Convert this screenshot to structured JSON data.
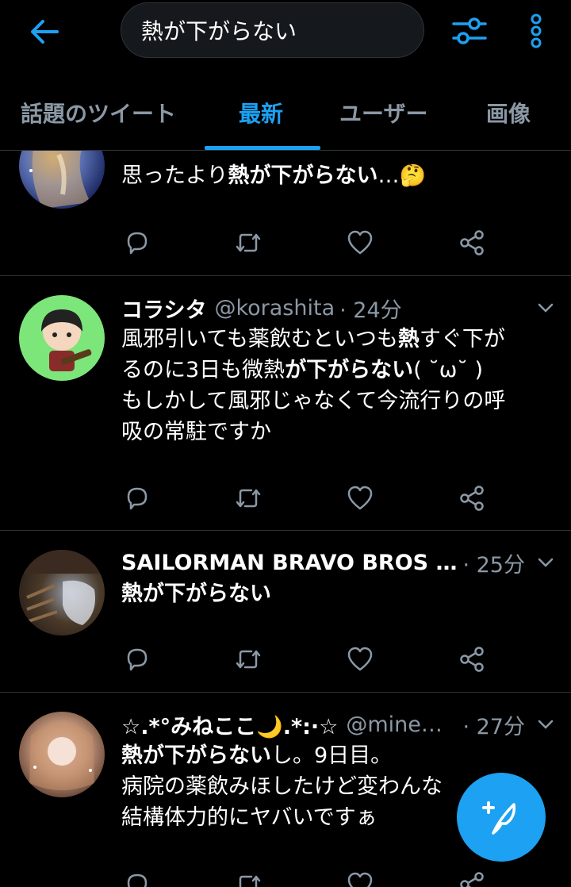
{
  "search": {
    "query": "熱が下がらない"
  },
  "tabs": [
    {
      "label": "話題のツイート",
      "active": false
    },
    {
      "label": "最新",
      "active": true
    },
    {
      "label": "ユーザー",
      "active": false
    },
    {
      "label": "画像",
      "active": false
    }
  ],
  "tweets": [
    {
      "text_plain": "思ったより",
      "text_bold": "熱が下がらない",
      "text_tail": "…🤔"
    },
    {
      "name": "コラシタ",
      "handle": "@korashita",
      "time": "· 24分",
      "line1_a": "風邪引いても薬飲むといつも",
      "line1_b": "熱",
      "line1_c": "すぐ下が",
      "line2_a": "るのに3日も微熱",
      "line2_b": "が下がらない",
      "line2_c": "( ˘ω˘ )",
      "line3": "もしかして風邪じゃなくて今流行りの呼",
      "line4": "吸の常駐ですか"
    },
    {
      "name": "SAILORMAN BRAVO BROS …",
      "time": "· 25分",
      "text_bold": "熱が下がらない"
    },
    {
      "name": "☆.*°みねここ🌙.*:·☆",
      "handle": "@mine…",
      "time": "· 27分",
      "line1_b": "熱が下がらない",
      "line1_c": "し。9日目。",
      "line2": "病院の薬飲みほしたけど変わんな",
      "line3": "結構体力的にヤバいですぁ"
    }
  ],
  "colors": {
    "accent": "#1da1f2",
    "background": "#000000",
    "muted": "#8b98a5",
    "divider": "#2f3336"
  },
  "icons": {
    "back": "arrow-left-icon",
    "filter": "sliders-icon",
    "more": "vertical-dots-icon",
    "reply": "reply-icon",
    "retweet": "retweet-icon",
    "like": "heart-icon",
    "share": "share-icon",
    "compose": "feather-plus-icon"
  }
}
